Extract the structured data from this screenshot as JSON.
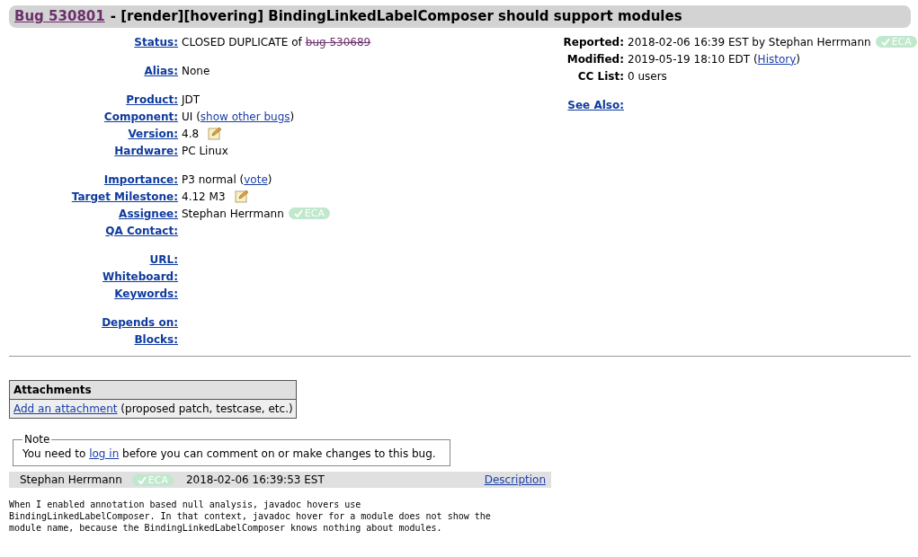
{
  "title": {
    "bug_link": "Bug 530801",
    "summary": "- [render][hovering] BindingLinkedLabelComposer should support modules"
  },
  "left_groups": [
    [
      {
        "label": "Status:",
        "linked": true,
        "value": [
          {
            "kind": "text",
            "text": "CLOSED DUPLICATE of"
          },
          {
            "kind": "struck_link",
            "text": "bug 530689"
          }
        ]
      }
    ],
    [
      {
        "label": "Alias:",
        "linked": true,
        "value": [
          {
            "kind": "text",
            "text": "None"
          }
        ]
      }
    ],
    [
      {
        "label": "Product:",
        "linked": true,
        "value": [
          {
            "kind": "text",
            "text": "JDT"
          }
        ]
      },
      {
        "label": "Component:",
        "linked": true,
        "value": [
          {
            "kind": "text",
            "text": "UI ("
          },
          {
            "kind": "link",
            "text": "show other bugs"
          },
          {
            "kind": "text",
            "text": ")"
          }
        ]
      },
      {
        "label": "Version:",
        "linked": true,
        "value": [
          {
            "kind": "text",
            "text": "4.8"
          },
          {
            "kind": "edit"
          }
        ]
      },
      {
        "label": "Hardware:",
        "linked": true,
        "value": [
          {
            "kind": "text",
            "text": "PC Linux"
          }
        ]
      }
    ],
    [
      {
        "label": "Importance:",
        "linked": true,
        "value": [
          {
            "kind": "text",
            "text": "P3 normal ("
          },
          {
            "kind": "link",
            "text": "vote"
          },
          {
            "kind": "text",
            "text": ")"
          }
        ]
      },
      {
        "label": "Target Milestone:",
        "linked": true,
        "value": [
          {
            "kind": "text",
            "text": "4.12 M3"
          },
          {
            "kind": "edit"
          }
        ]
      },
      {
        "label": "Assignee:",
        "linked": true,
        "value": [
          {
            "kind": "text",
            "text": "Stephan Herrmann"
          },
          {
            "kind": "badge",
            "text": "ECA"
          }
        ]
      },
      {
        "label": "QA Contact:",
        "linked": true
      }
    ],
    [
      {
        "label": "URL:",
        "linked": true
      },
      {
        "label": "Whiteboard:",
        "linked": true
      },
      {
        "label": "Keywords:",
        "linked": true
      }
    ],
    [
      {
        "label": "Depends on:",
        "linked": true
      },
      {
        "label": "Blocks:",
        "linked": true
      }
    ]
  ],
  "right_groups": [
    [
      {
        "label": "Reported:",
        "linked": false,
        "value": [
          {
            "kind": "text",
            "text": "2018-02-06 16:39 EST by Stephan Herrmann"
          },
          {
            "kind": "badge",
            "text": "ECA"
          }
        ]
      },
      {
        "label": "Modified:",
        "linked": false,
        "value": [
          {
            "kind": "text",
            "text": "2019-05-19 18:10 EDT ("
          },
          {
            "kind": "link",
            "text": "History"
          },
          {
            "kind": "text",
            "text": ")"
          }
        ]
      },
      {
        "label": "CC List:",
        "linked": false,
        "value": [
          {
            "kind": "text",
            "text": "0 users"
          }
        ]
      }
    ],
    [
      {
        "label": "See Also:",
        "linked": true
      }
    ]
  ],
  "attachments": {
    "header": "Attachments",
    "link": "Add an attachment",
    "hint": "(proposed patch, testcase, etc.)"
  },
  "note": {
    "legend": "Note",
    "before": "You need to",
    "link": "log in",
    "after": "before you can comment on or make changes to this bug."
  },
  "comment": {
    "author": "Stephan Herrmann",
    "badge": "ECA",
    "time": "2018-02-06 16:39:53 EST",
    "link": "Description",
    "lines": [
      "When I enabled annotation based null analysis, javadoc hovers use",
      "BindingLinkedLabelComposer. In that context, javadoc hover for a module does not show the",
      "module name, because the BindingLinkedLabelComposer knows nothing about modules."
    ]
  }
}
